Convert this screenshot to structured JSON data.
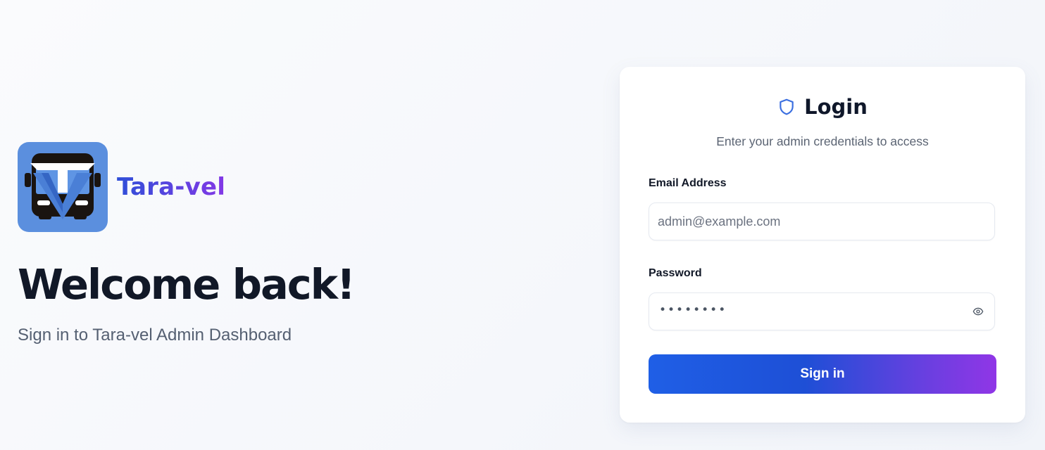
{
  "brand": {
    "name": "Tara-vel",
    "logo_icon": "bus-logo-icon",
    "logo_bg_color": "#5b8fde"
  },
  "hero": {
    "title": "Welcome back!",
    "subtitle": "Sign in to Tara-vel Admin Dashboard"
  },
  "login": {
    "icon": "shield-icon",
    "title": "Login",
    "subtitle": "Enter your admin credentials to access",
    "email_label": "Email Address",
    "email_placeholder": "admin@example.com",
    "email_value": "",
    "password_label": "Password",
    "password_masked": "••••••••",
    "password_toggle_icon": "eye-icon",
    "submit_label": "Sign in"
  },
  "colors": {
    "accent_blue": "#1f5fe6",
    "accent_purple": "#9036e6",
    "shield_blue": "#3b6fe0"
  }
}
